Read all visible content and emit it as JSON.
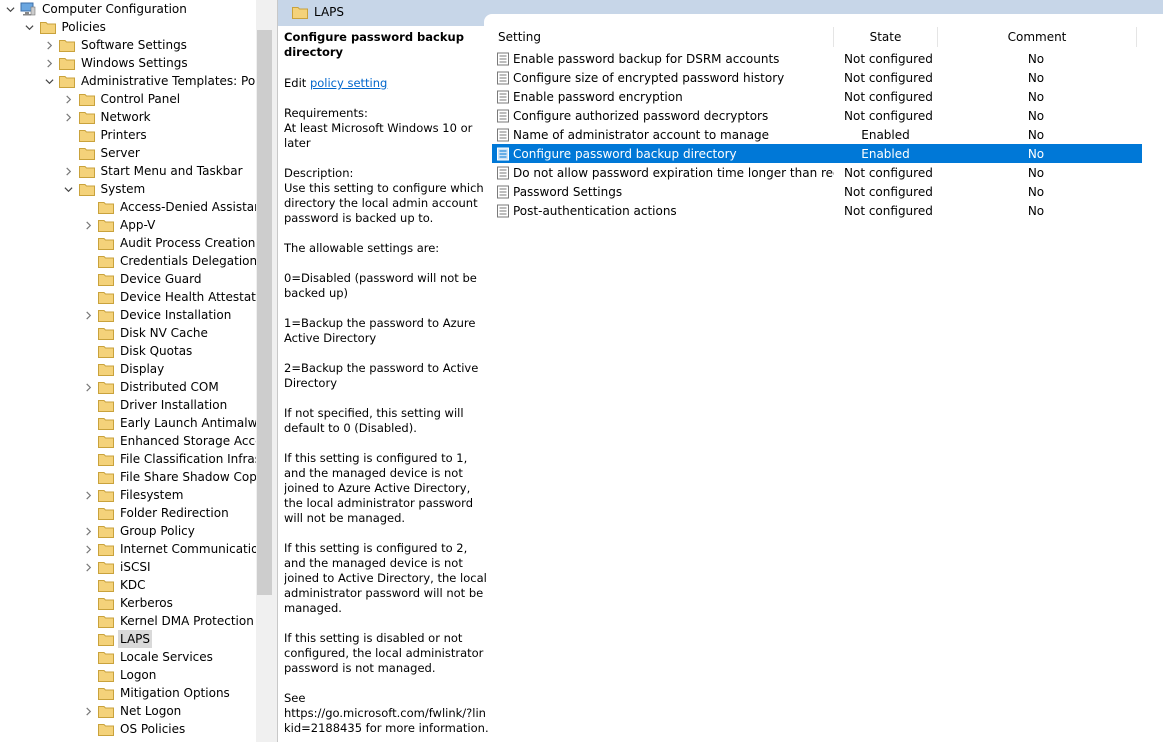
{
  "tree": {
    "root": "Computer Configuration",
    "items": [
      {
        "label": "Policies"
      },
      {
        "label": "Software Settings"
      },
      {
        "label": "Windows Settings"
      },
      {
        "label": "Administrative Templates: Policy"
      },
      {
        "label": "Control Panel"
      },
      {
        "label": "Network"
      },
      {
        "label": "Printers"
      },
      {
        "label": "Server"
      },
      {
        "label": "Start Menu and Taskbar"
      },
      {
        "label": "System"
      },
      {
        "label": "Access-Denied Assistance"
      },
      {
        "label": "App-V"
      },
      {
        "label": "Audit Process Creation"
      },
      {
        "label": "Credentials Delegation"
      },
      {
        "label": "Device Guard"
      },
      {
        "label": "Device Health Attestation"
      },
      {
        "label": "Device Installation"
      },
      {
        "label": "Disk NV Cache"
      },
      {
        "label": "Disk Quotas"
      },
      {
        "label": "Display"
      },
      {
        "label": "Distributed COM"
      },
      {
        "label": "Driver Installation"
      },
      {
        "label": "Early Launch Antimalware"
      },
      {
        "label": "Enhanced Storage Access"
      },
      {
        "label": "File Classification Infrastru"
      },
      {
        "label": "File Share Shadow Copy P"
      },
      {
        "label": "Filesystem"
      },
      {
        "label": "Folder Redirection"
      },
      {
        "label": "Group Policy"
      },
      {
        "label": "Internet Communication"
      },
      {
        "label": "iSCSI"
      },
      {
        "label": "KDC"
      },
      {
        "label": "Kerberos"
      },
      {
        "label": "Kernel DMA Protection"
      },
      {
        "label": "LAPS"
      },
      {
        "label": "Locale Services"
      },
      {
        "label": "Logon"
      },
      {
        "label": "Mitigation Options"
      },
      {
        "label": "Net Logon"
      },
      {
        "label": "OS Policies"
      }
    ]
  },
  "header": {
    "title": "LAPS"
  },
  "description": {
    "title": "Configure password backup directory",
    "edit_prefix": "Edit",
    "edit_link": "policy setting",
    "requirements_label": "Requirements:",
    "requirements": "At least Microsoft Windows 10 or later",
    "description_label": "Description:",
    "p1": "Use this setting to configure which directory the local admin account password is backed up to.",
    "p2": "The allowable settings are:",
    "p3": "0=Disabled (password will not be backed up)",
    "p4": "1=Backup the password to Azure Active Directory",
    "p5": "2=Backup the password to Active Directory",
    "p6": "If not specified, this setting will default to 0 (Disabled).",
    "p7": "If this setting is configured to 1, and the managed device is not joined to Azure Active Directory, the local administrator password will not be managed.",
    "p8": "If this setting is configured to 2, and the managed device is not joined to Active Directory, the local administrator password will not be managed.",
    "p9": "If this setting is disabled or not configured, the local administrator password is not managed.",
    "p10_label": "See",
    "p10": "https://go.microsoft.com/fwlink/?linkid=2188435 for more information."
  },
  "list": {
    "columns": {
      "setting": "Setting",
      "state": "State",
      "comment": "Comment"
    },
    "rows": [
      {
        "setting": "Enable password backup for DSRM accounts",
        "state": "Not configured",
        "comment": "No"
      },
      {
        "setting": "Configure size of encrypted password history",
        "state": "Not configured",
        "comment": "No"
      },
      {
        "setting": "Enable password encryption",
        "state": "Not configured",
        "comment": "No"
      },
      {
        "setting": "Configure authorized password decryptors",
        "state": "Not configured",
        "comment": "No"
      },
      {
        "setting": "Name of administrator account to manage",
        "state": "Enabled",
        "comment": "No"
      },
      {
        "setting": "Configure password backup directory",
        "state": "Enabled",
        "comment": "No"
      },
      {
        "setting": "Do not allow password expiration time longer than required ...",
        "state": "Not configured",
        "comment": "No"
      },
      {
        "setting": "Password Settings",
        "state": "Not configured",
        "comment": "No"
      },
      {
        "setting": "Post-authentication actions",
        "state": "Not configured",
        "comment": "No"
      }
    ]
  },
  "colors": {
    "selection": "#0078d7",
    "tab": "#c7d6e8",
    "folder": "#f4d27a",
    "link": "#0066cc"
  }
}
